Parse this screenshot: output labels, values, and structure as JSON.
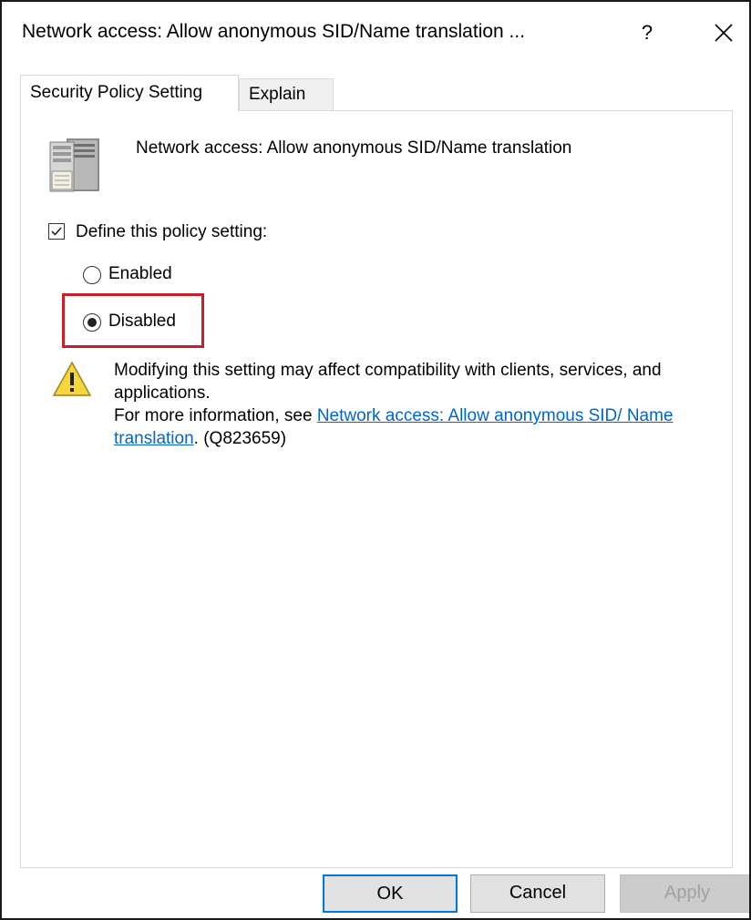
{
  "window": {
    "title": "Network access: Allow anonymous SID/Name translation ...",
    "help_label": "?",
    "close_icon": "close-icon"
  },
  "tabs": [
    {
      "label": "Security Policy Setting",
      "active": true
    },
    {
      "label": "Explain",
      "active": false
    }
  ],
  "policy": {
    "icon": "server-icon",
    "name": "Network access: Allow anonymous SID/Name translation",
    "define_label": "Define this policy setting:",
    "define_checked": true,
    "options": [
      {
        "label": "Enabled",
        "selected": false
      },
      {
        "label": "Disabled",
        "selected": true
      }
    ]
  },
  "warning": {
    "icon": "warning-icon",
    "line1": "Modifying this setting may affect compatibility with clients, services, and applications.",
    "more_info_prefix": "For more information, see ",
    "link_text": "Network access: Allow anonymous SID/ Name translation",
    "suffix": ". (Q823659)"
  },
  "buttons": {
    "ok": "OK",
    "cancel": "Cancel",
    "apply": "Apply"
  },
  "colors": {
    "highlight": "#c8202b",
    "link": "#0066cc",
    "ok_border": "#0078d7"
  }
}
